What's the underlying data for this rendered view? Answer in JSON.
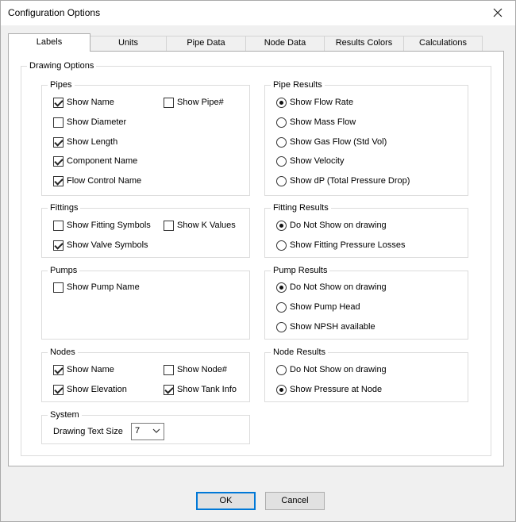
{
  "window": {
    "title": "Configuration Options"
  },
  "tabs": [
    {
      "label": "Labels",
      "active": true
    },
    {
      "label": "Units"
    },
    {
      "label": "Pipe Data"
    },
    {
      "label": "Node Data"
    },
    {
      "label": "Results Colors"
    },
    {
      "label": "Calculations"
    }
  ],
  "drawing_options": {
    "label": "Drawing Options",
    "pipes": {
      "label": "Pipes",
      "items": [
        {
          "label": "Show Name",
          "checked": true
        },
        {
          "label": "Show Pipe#",
          "checked": false
        },
        {
          "label": "Show Diameter",
          "checked": false
        },
        {
          "label": "Show Length",
          "checked": true
        },
        {
          "label": "Component Name",
          "checked": true
        },
        {
          "label": "Flow Control Name",
          "checked": true
        }
      ]
    },
    "fittings": {
      "label": "Fittings",
      "items": [
        {
          "label": "Show Fitting Symbols",
          "checked": false
        },
        {
          "label": "Show K Values",
          "checked": false
        },
        {
          "label": "Show Valve Symbols",
          "checked": true
        }
      ]
    },
    "pumps": {
      "label": "Pumps",
      "items": [
        {
          "label": "Show Pump Name",
          "checked": false
        }
      ]
    },
    "nodes": {
      "label": "Nodes",
      "items": [
        {
          "label": "Show Name",
          "checked": true
        },
        {
          "label": "Show Node#",
          "checked": false
        },
        {
          "label": "Show Elevation",
          "checked": true
        },
        {
          "label": "Show Tank Info",
          "checked": true
        }
      ]
    },
    "system": {
      "label": "System",
      "text_size_label": "Drawing Text Size",
      "text_size_value": "7"
    },
    "pipe_results": {
      "label": "Pipe Results",
      "options": [
        {
          "label": "Show Flow Rate",
          "selected": true
        },
        {
          "label": "Show Mass Flow",
          "selected": false
        },
        {
          "label": "Show Gas Flow (Std Vol)",
          "selected": false
        },
        {
          "label": "Show Velocity",
          "selected": false
        },
        {
          "label": "Show dP (Total Pressure Drop)",
          "selected": false
        }
      ]
    },
    "fitting_results": {
      "label": "Fitting Results",
      "options": [
        {
          "label": "Do Not Show on drawing",
          "selected": true
        },
        {
          "label": "Show Fitting Pressure Losses",
          "selected": false
        }
      ]
    },
    "pump_results": {
      "label": "Pump Results",
      "options": [
        {
          "label": "Do Not Show on drawing",
          "selected": true
        },
        {
          "label": "Show Pump Head",
          "selected": false
        },
        {
          "label": "Show NPSH available",
          "selected": false
        }
      ]
    },
    "node_results": {
      "label": "Node Results",
      "options": [
        {
          "label": "Do Not Show on drawing",
          "selected": false
        },
        {
          "label": "Show Pressure at Node",
          "selected": true
        }
      ]
    }
  },
  "buttons": {
    "ok": "OK",
    "cancel": "Cancel"
  },
  "icons": {
    "close": "close-icon",
    "dropdown": "chevron-down-icon"
  },
  "colors": {
    "accent": "#0078d7",
    "window_bg": "#f0f0f0",
    "panel_bg": "#ffffff"
  }
}
